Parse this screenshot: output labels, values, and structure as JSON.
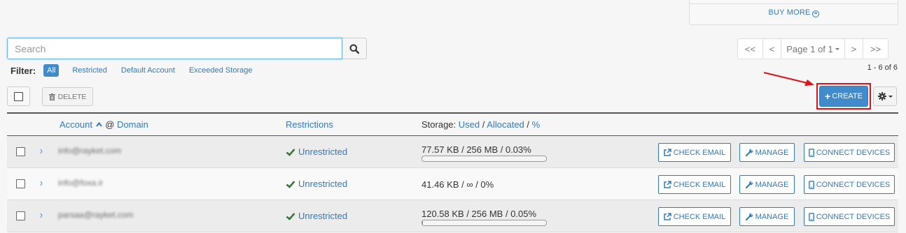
{
  "buy_more": {
    "label": "BUY MORE"
  },
  "search": {
    "placeholder": "Search",
    "value": ""
  },
  "pagination": {
    "first": "<<",
    "prev": "<",
    "page_label": "Page 1 of 1",
    "next": ">",
    "last": ">>"
  },
  "filter": {
    "label": "Filter:",
    "options": [
      {
        "label": "All",
        "active": true
      },
      {
        "label": "Restricted",
        "active": false
      },
      {
        "label": "Default Account",
        "active": false
      },
      {
        "label": "Exceeded Storage",
        "active": false
      }
    ]
  },
  "range_text": "1 - 6 of 6",
  "toolbar": {
    "delete_label": "DELETE",
    "create_label": "CREATE"
  },
  "table": {
    "headers": {
      "account": "Account",
      "at": "@",
      "domain": "Domain",
      "restrictions": "Restrictions",
      "storage": "Storage:",
      "used": "Used",
      "sep1": "/",
      "allocated": "Allocated",
      "sep2": "/",
      "percent": "%"
    },
    "rows": [
      {
        "account": "info@rayket.com",
        "restriction": "Unrestricted",
        "usage": "77.57 KB / 256 MB / 0.03%",
        "percent": 0.0003,
        "has_bar": true
      },
      {
        "account": "info@foxa.ir",
        "restriction": "Unrestricted",
        "usage": "41.46 KB / ∞ / 0%",
        "percent": 0,
        "has_bar": false
      },
      {
        "account": "parsaa@rayket.com",
        "restriction": "Unrestricted",
        "usage": "120.58 KB / 256 MB / 0.05%",
        "percent": 0.0005,
        "has_bar": true
      }
    ],
    "actions": {
      "check_email": "CHECK EMAIL",
      "manage": "MANAGE",
      "connect_devices": "CONNECT DEVICES"
    }
  },
  "colors": {
    "primary": "#428bca",
    "link": "#337ab7",
    "highlight": "#d9141b",
    "success": "#3c763d"
  }
}
